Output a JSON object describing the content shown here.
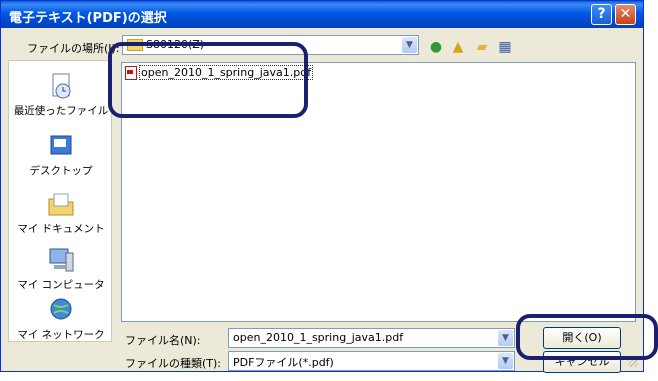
{
  "window": {
    "title": "電子テキスト(PDF)の選択",
    "help_glyph": "?",
    "close_glyph": "✕"
  },
  "toolbar": {
    "lookin_label": "ファイルの場所(I):",
    "lookin_value": "S80120(Z)",
    "icons": [
      "back-icon",
      "up-folder-icon",
      "new-folder-icon",
      "view-menu-icon"
    ]
  },
  "places": [
    {
      "label": "最近使ったファイル",
      "icon": "recent-documents-icon"
    },
    {
      "label": "デスクトップ",
      "icon": "desktop-icon"
    },
    {
      "label": "マイ ドキュメント",
      "icon": "my-documents-icon"
    },
    {
      "label": "マイ コンピュータ",
      "icon": "my-computer-icon"
    },
    {
      "label": "マイ ネットワーク",
      "icon": "my-network-icon"
    }
  ],
  "files": [
    {
      "name": "open_2010_1_spring_java1.pdf",
      "icon": "pdf-icon"
    }
  ],
  "form": {
    "filename_label": "ファイル名(N):",
    "filename_value": "open_2010_1_spring_java1.pdf",
    "filetype_label": "ファイルの種類(T):",
    "filetype_value": "PDFファイル(*.pdf)"
  },
  "buttons": {
    "open": "開く(O)",
    "cancel": "キャンセル"
  }
}
